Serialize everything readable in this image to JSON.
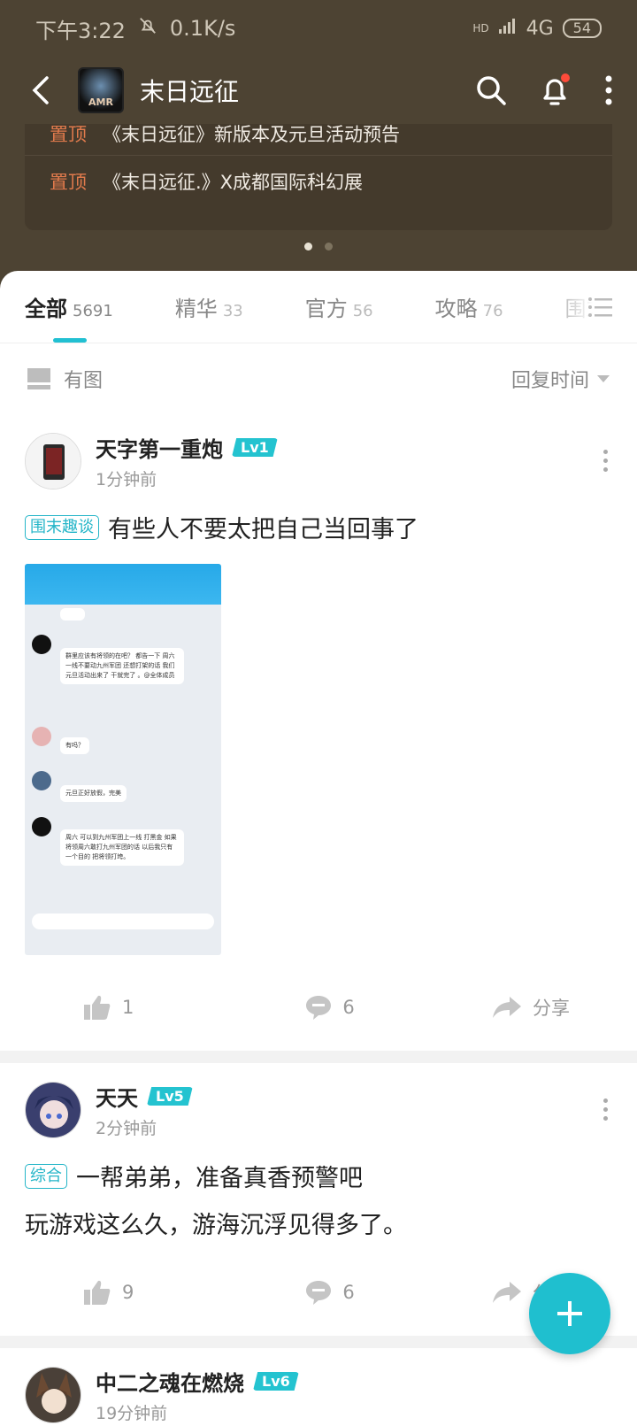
{
  "status_bar": {
    "time": "下午3:22",
    "net_speed": "0.1K/s",
    "signal": "4G",
    "hd": "HD",
    "battery": "54"
  },
  "app_bar": {
    "logo_text": "AMR",
    "title": "末日远征"
  },
  "pinned": [
    {
      "tag": "置顶",
      "text": "《末日远征》新版本及元旦活动预告"
    },
    {
      "tag": "置顶",
      "text": "《末日远征.》X成都国际科幻展"
    }
  ],
  "tabs": [
    {
      "label": "全部",
      "count": "5691"
    },
    {
      "label": "精华",
      "count": "33"
    },
    {
      "label": "官方",
      "count": "56"
    },
    {
      "label": "攻略",
      "count": "76"
    },
    {
      "label": "围末",
      "count": ""
    }
  ],
  "filter": {
    "has_image": "有图",
    "sort": "回复时间"
  },
  "posts": [
    {
      "user": "天字第一重炮",
      "level": "Lv1",
      "time": "1分钟前",
      "category": "围末趣谈",
      "title": "有些人不要太把自己当回事了",
      "likes": "1",
      "comments": "6",
      "share": "分享"
    },
    {
      "user": "天天",
      "level": "Lv5",
      "time": "2分钟前",
      "category": "综合",
      "title": "一帮弟弟，准备真香预警吧",
      "body": "玩游戏这么久，游海沉浮见得多了。",
      "likes": "9",
      "comments": "6",
      "share": "分享"
    },
    {
      "user": "中二之魂在燃烧",
      "level": "Lv6",
      "time": "19分钟前"
    }
  ],
  "screenshot_chat": [
    "群里应该有将领的在吧？ 都告一下 周六 一线不要动九州军团 还想打架的话 我们元旦活动出来了 干就完了 。@全体成员",
    "有吗？",
    "元旦正好放假，完美",
    "周六 可以到九州军团上一线 打黑金 如果将领周六敢打九州军团的话 以后我只有一个目的 把将领打垮。"
  ],
  "colors": {
    "accent": "#21c0d2",
    "header_bg": "#4d4333",
    "pin_tag": "#e07a4c",
    "notify_dot": "#ff4b3a"
  }
}
